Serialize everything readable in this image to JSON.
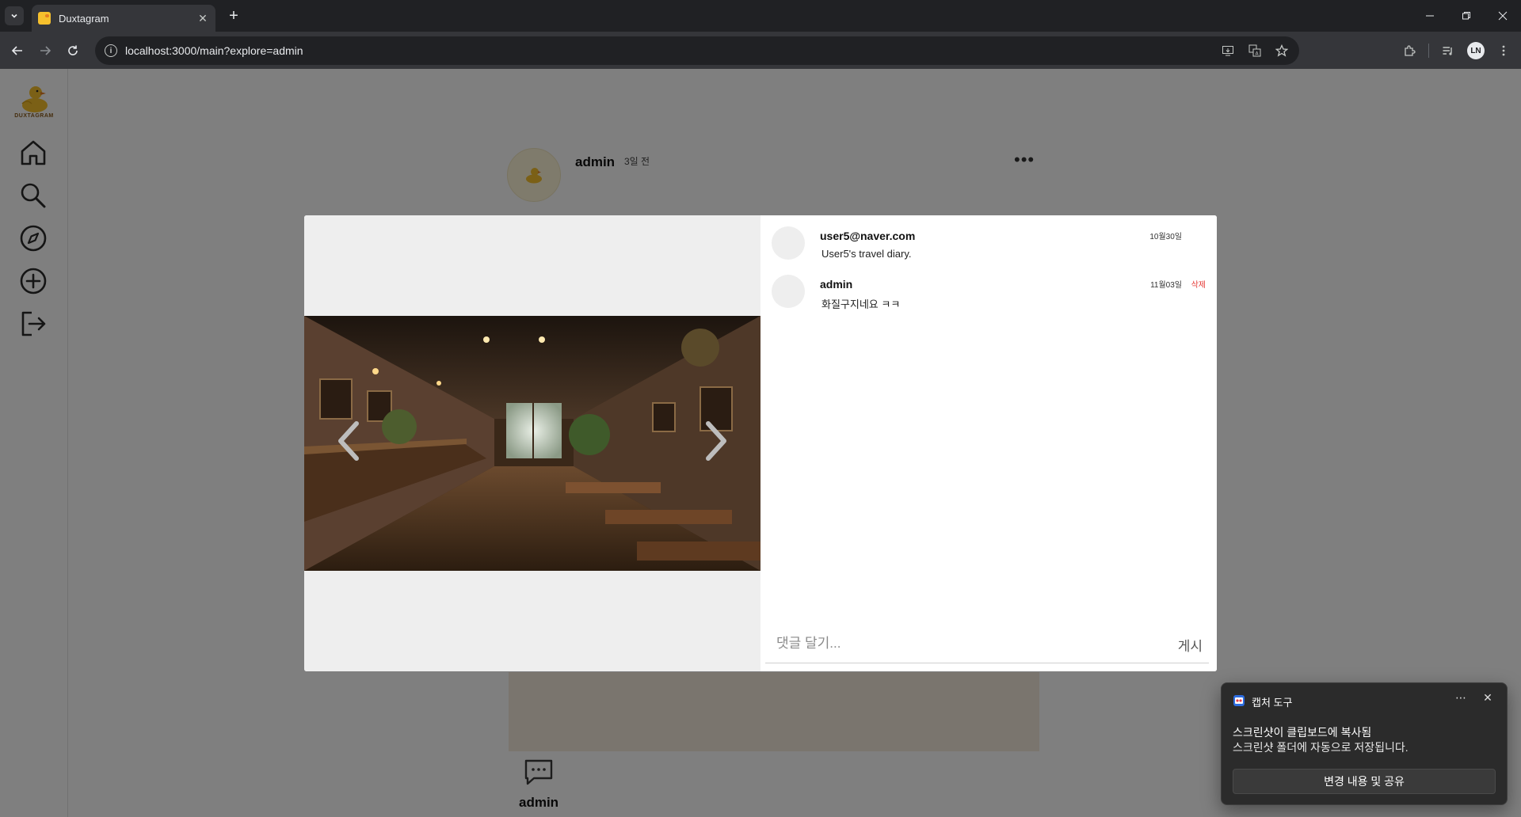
{
  "browser": {
    "tab_title": "Duxtagram",
    "tab_close": "✕",
    "new_tab": "+",
    "url": "localhost:3000/main?explore=admin",
    "profile_initials": "LN"
  },
  "sidebar": {
    "logo_text": "DUXTAGRAM",
    "items": [
      {
        "name": "home",
        "icon": "home-icon"
      },
      {
        "name": "search",
        "icon": "search-icon"
      },
      {
        "name": "explore",
        "icon": "compass-icon"
      },
      {
        "name": "create",
        "icon": "plus-circle-icon"
      },
      {
        "name": "logout",
        "icon": "logout-icon"
      }
    ]
  },
  "feed_post": {
    "author": "admin",
    "time_ago": "3일 전",
    "more": "•••",
    "footer_name": "admin"
  },
  "modal": {
    "comments": [
      {
        "author": "user5@naver.com",
        "text": "User5's travel diary.",
        "date": "10월30일",
        "deletable": false
      },
      {
        "author": "admin",
        "text": "화질구지네요 ㅋㅋ",
        "date": "11월03일",
        "deletable": true,
        "delete_label": "삭제"
      }
    ],
    "comment_placeholder": "댓글 달기...",
    "post_button": "게시"
  },
  "toast": {
    "app_name": "캡처 도구",
    "more": "⋯",
    "close": "✕",
    "line1": "스크린샷이 클립보드에 복사됨",
    "line2": "스크린샷 폴더에 자동으로 저장됩니다.",
    "action": "변경 내용 및 공유"
  },
  "colors": {
    "accent_delete": "#e53935",
    "overlay": "rgba(0,0,0,0.5)"
  }
}
